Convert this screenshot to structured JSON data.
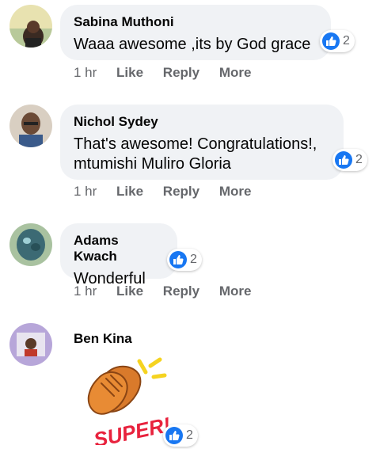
{
  "comments": [
    {
      "author": "Sabina Muthoni",
      "text": "Waaa awesome ,its by God grace",
      "reaction_count": "2",
      "time": "1 hr",
      "like": "Like",
      "reply": "Reply",
      "more": "More"
    },
    {
      "author": "Nichol Sydey",
      "text": "That's awesome! Congratulations!, mtumishi Muliro Gloria",
      "reaction_count": "2",
      "time": "1 hr",
      "like": "Like",
      "reply": "Reply",
      "more": "More"
    },
    {
      "author": "Adams Kwach",
      "text": "Wonderful",
      "reaction_count": "2",
      "time": "1 hr",
      "like": "Like",
      "reply": "Reply",
      "more": "More"
    },
    {
      "author": "Ben Kina",
      "sticker_text": "SUPER!",
      "reaction_count": "2"
    }
  ],
  "colors": {
    "like_blue": "#1877f2",
    "bubble_bg": "#f0f2f5",
    "meta_gray": "#65676b",
    "sticker_red": "#e8223d"
  }
}
